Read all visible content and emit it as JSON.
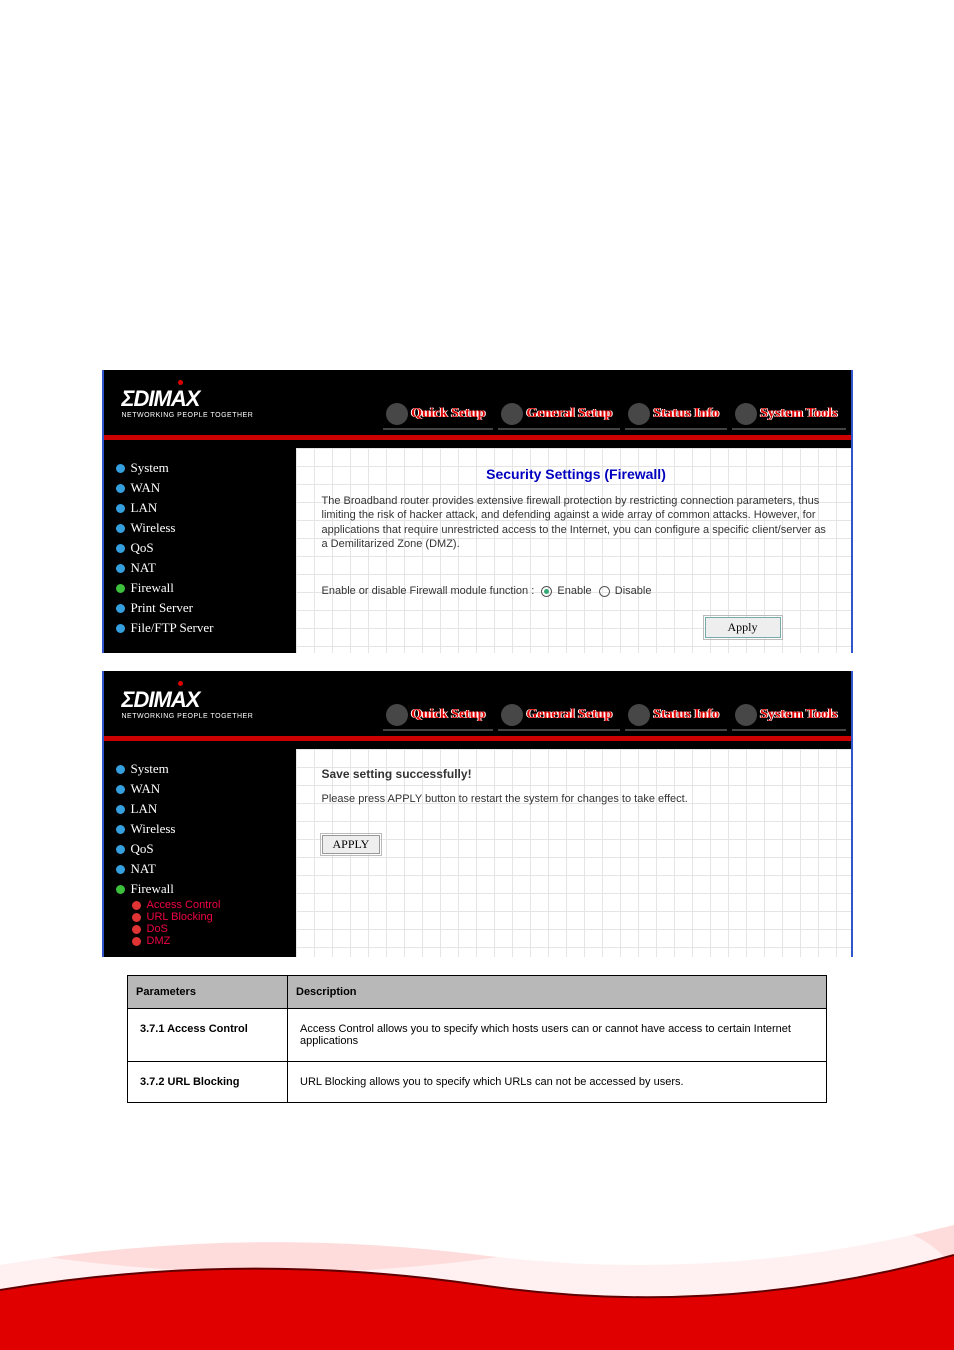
{
  "logo": {
    "brand": "ΣDIMAX",
    "tagline": "NETWORKING PEOPLE TOGETHER"
  },
  "nav": {
    "quick_setup": "Quick Setup",
    "general_setup": "General Setup",
    "status_info": "Status Info",
    "system_tools": "System Tools"
  },
  "sidebar": {
    "system": "System",
    "wan": "WAN",
    "lan": "LAN",
    "wireless": "Wireless",
    "qos": "QoS",
    "nat": "NAT",
    "firewall": "Firewall",
    "print_server": "Print Server",
    "file_ftp": "File/FTP Server",
    "access_control": "Access Control",
    "url_blocking": "URL Blocking",
    "dos": "DoS",
    "dmz": "DMZ"
  },
  "panel1": {
    "title": "Security Settings (Firewall)",
    "desc": "The Broadband router provides extensive firewall protection by restricting connection parameters, thus limiting the risk of hacker attack, and defending against a wide array of common attacks. However, for applications that require unrestricted access to the Internet, you can configure a specific client/server as a Demilitarized Zone (DMZ).",
    "toggle_label": "Enable or disable Firewall module function :",
    "enable_label": "Enable",
    "disable_label": "Disable",
    "apply_btn": "Apply"
  },
  "panel2": {
    "save_title": "Save setting successfully!",
    "save_msg": "Please press APPLY button to restart the system for changes to take effect.",
    "apply_btn": "APPLY"
  },
  "table": {
    "h1": "Parameters",
    "h2": "Description",
    "r1c1": "3.7.1 Access Control",
    "r1c2": "Access Control allows you to specify which hosts users can or cannot have access to certain Internet applications",
    "r2c1": "3.7.2 URL Blocking",
    "r2c2": "URL Blocking allows you to specify which URLs can not be accessed by users."
  }
}
